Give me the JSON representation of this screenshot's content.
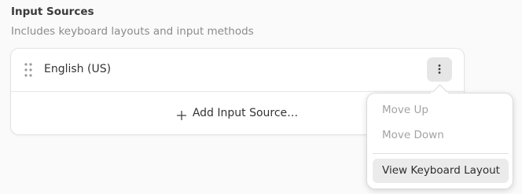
{
  "section": {
    "title": "Input Sources",
    "subtitle": "Includes keyboard layouts and input methods"
  },
  "input_sources": [
    {
      "label": "English (US)"
    }
  ],
  "add_row": {
    "label": "Add Input Source…",
    "icon": "plus-icon"
  },
  "row_menu_button": {
    "icon": "vertical-ellipsis-icon"
  },
  "popover_menu": {
    "items": [
      {
        "label": "Move Up",
        "enabled": false
      },
      {
        "label": "Move Down",
        "enabled": false
      },
      {
        "label": "View Keyboard Layout",
        "enabled": true,
        "highlighted": true
      }
    ]
  },
  "colors": {
    "background": "#fafafa",
    "card": "#ffffff",
    "muted_text": "#8b8b8b",
    "disabled_text": "#a3a3a3",
    "button_bg": "#e6e6e6",
    "hover_bg": "#ebebeb"
  }
}
